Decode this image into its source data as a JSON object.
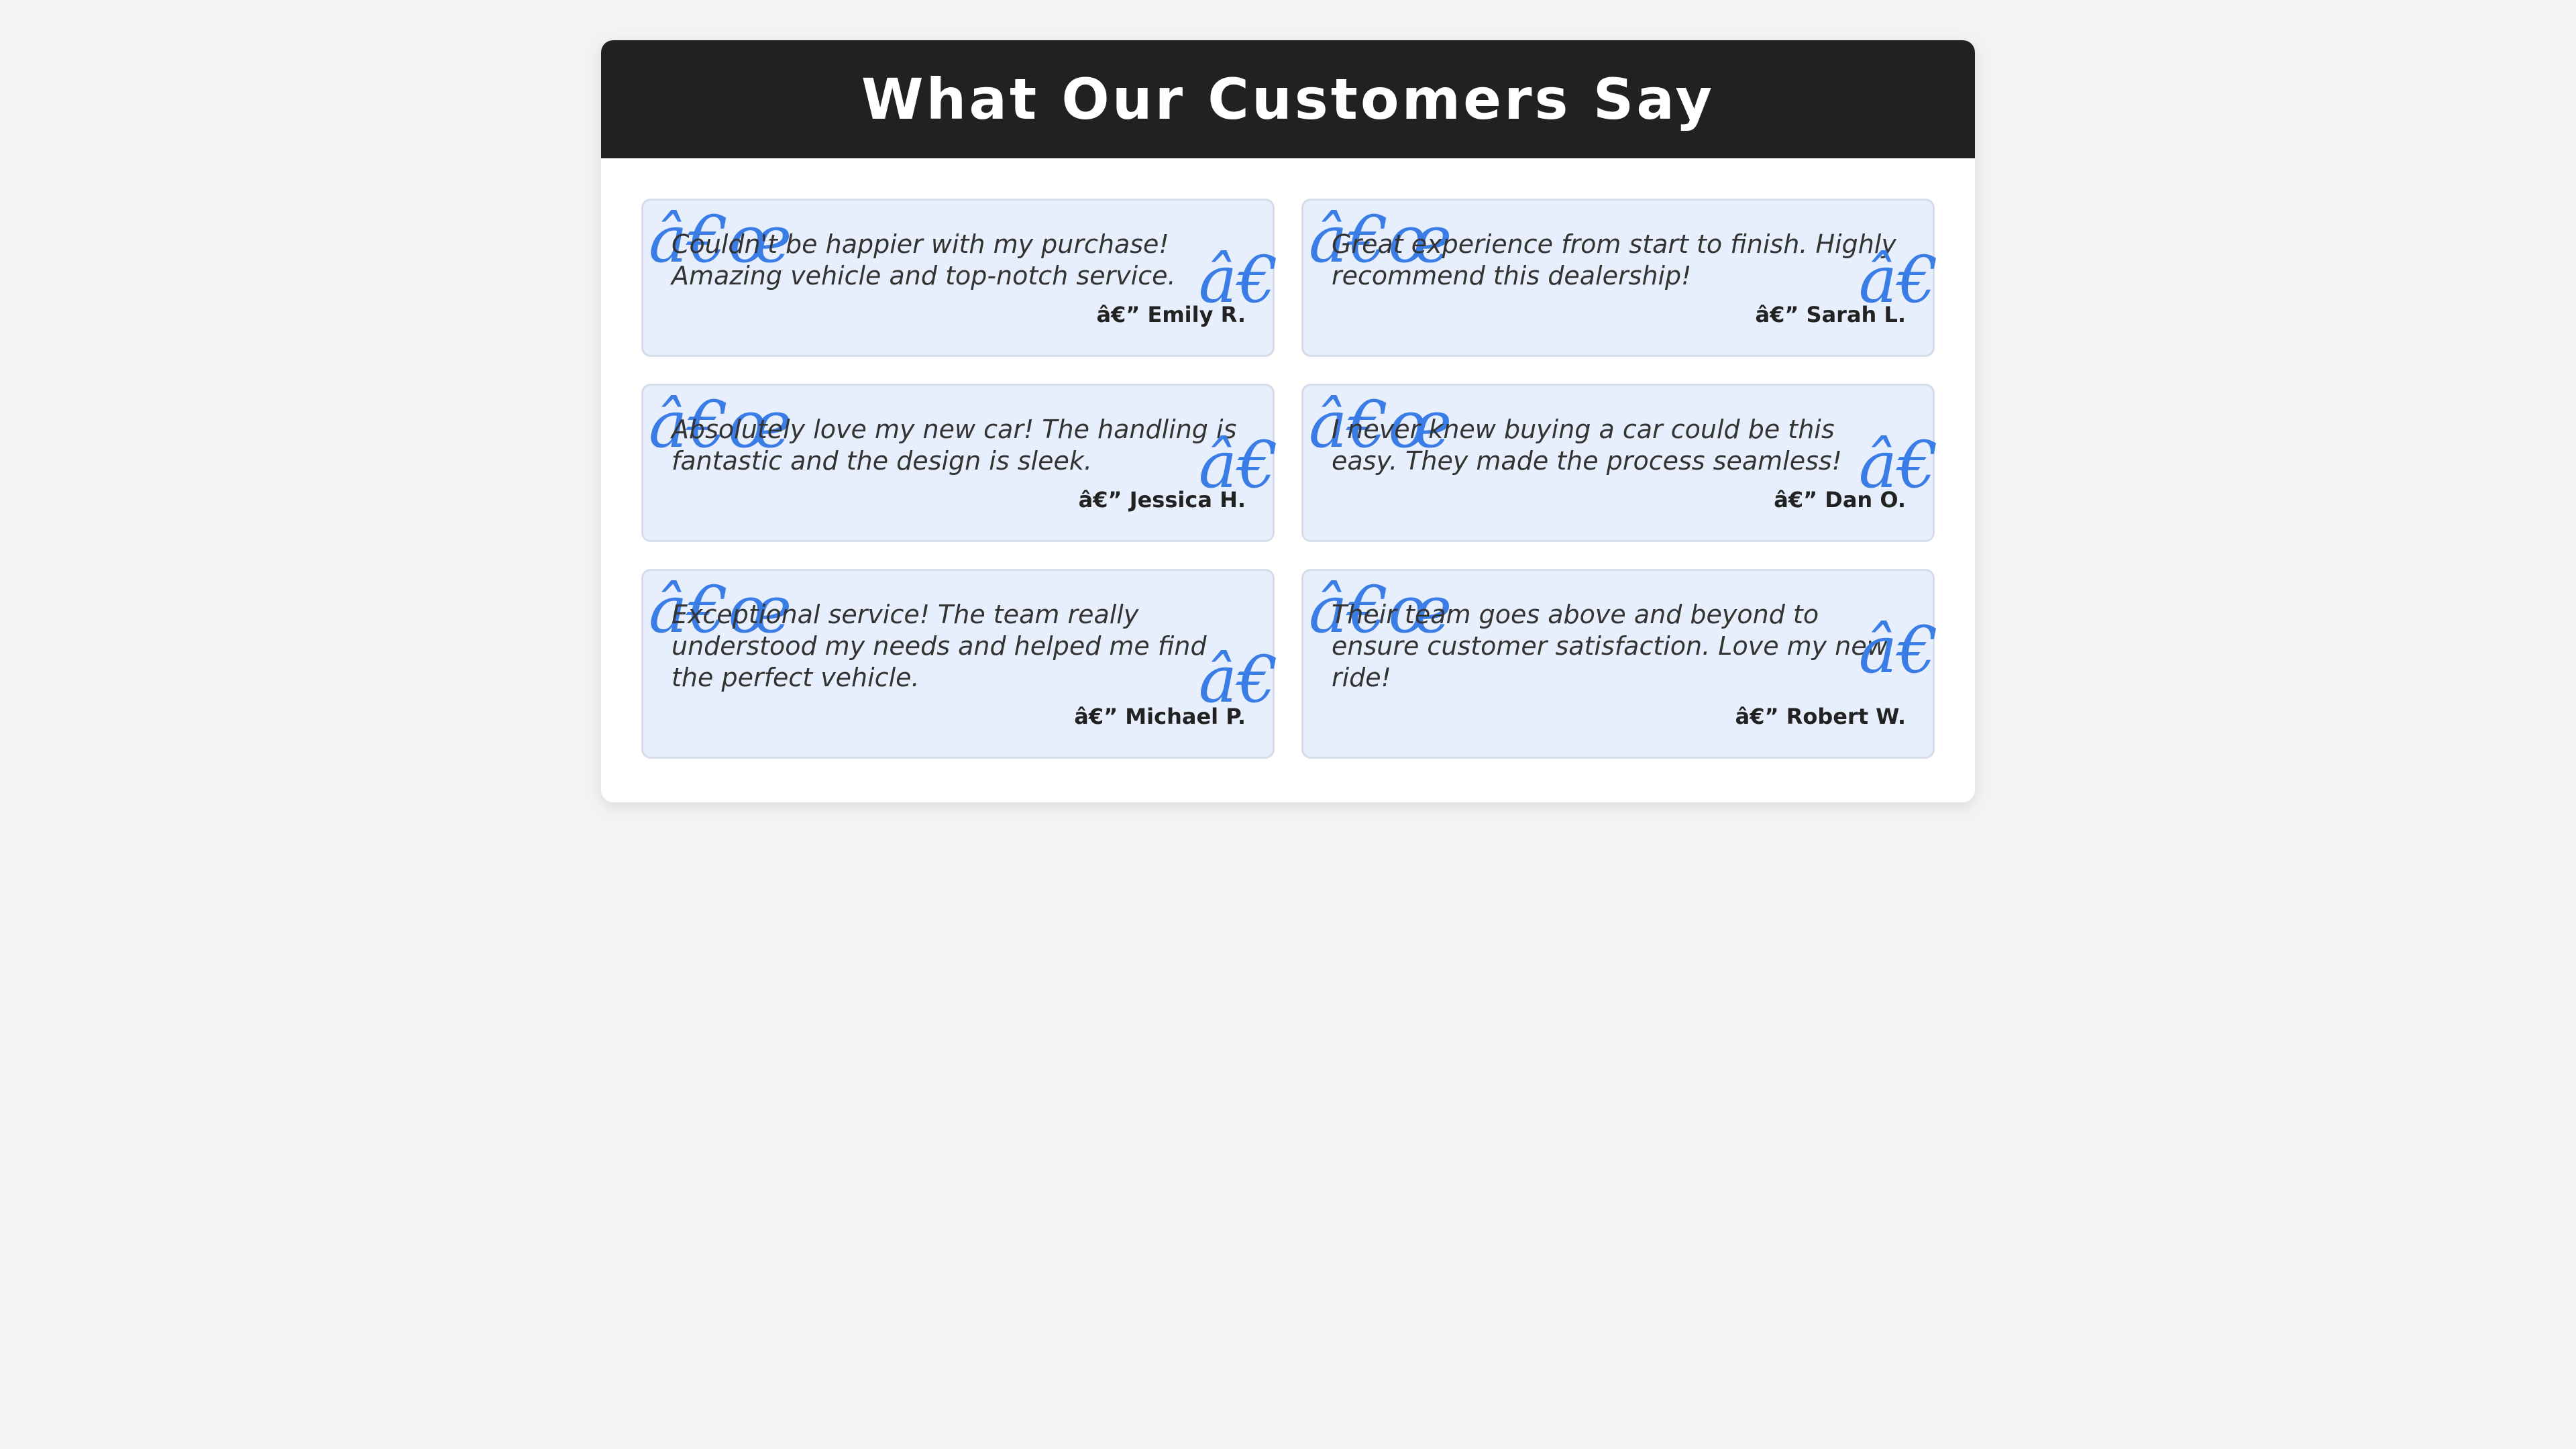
{
  "header": {
    "title": "What Our Customers Say"
  },
  "testimonials": [
    {
      "quote_open": "â€œ",
      "text": "Couldn't be happier with my purchase! Amazing vehicle and top-notch service.",
      "quote_close": "â€",
      "author": "â€” Emily R."
    },
    {
      "quote_open": "â€œ",
      "text": "Great experience from start to finish. Highly recommend this dealership!",
      "quote_close": "â€",
      "author": "â€” Sarah L."
    },
    {
      "quote_open": "â€œ",
      "text": "Absolutely love my new car! The handling is fantastic and the design is sleek.",
      "quote_close": "â€",
      "author": "â€” Jessica H."
    },
    {
      "quote_open": "â€œ",
      "text": "I never knew buying a car could be this easy. They made the process seamless!",
      "quote_close": "â€",
      "author": "â€” Dan O."
    },
    {
      "quote_open": "â€œ",
      "text": "Exceptional service! The team really understood my needs and helped me find the perfect vehicle.",
      "quote_close": "â€",
      "author": "â€” Michael P."
    },
    {
      "quote_open": "â€œ",
      "text": "Their team goes above and beyond to ensure customer satisfaction. Love my new ride!",
      "quote_close": "â€",
      "author": "â€” Robert W."
    }
  ],
  "colors": {
    "page_background": "#f3f3f3",
    "header_background": "#212121",
    "card_background": "#e8effc",
    "quote_mark": "#3b7de6"
  }
}
